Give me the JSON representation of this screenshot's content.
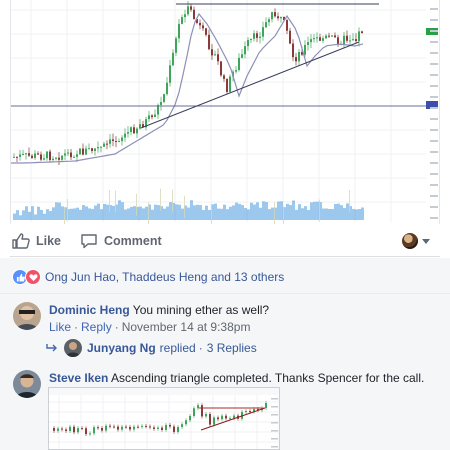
{
  "post": {
    "actions": {
      "like_label": "Like",
      "comment_label": "Comment"
    },
    "reactions": {
      "icons": [
        "like-icon",
        "love-icon"
      ],
      "summary": "Ong Jun Hao, Thaddeus Heng and 13 others"
    }
  },
  "comments": [
    {
      "author": "Dominic Heng",
      "text": "You mining ether as well?",
      "like_label": "Like",
      "reply_label": "Reply",
      "timestamp": "November 14 at 9:38pm",
      "reply_summary": {
        "author": "Junyang Ng",
        "action": "replied",
        "count_text": "3 Replies"
      }
    },
    {
      "author": "Steve Iken",
      "text": "Ascending triangle completed. Thanks Spencer for the call."
    }
  ],
  "colors": {
    "link": "#385898",
    "meta": "#616770",
    "like_reaction": "#5890ff",
    "love_reaction": "#f25268",
    "volume": "#4a9be0"
  }
}
